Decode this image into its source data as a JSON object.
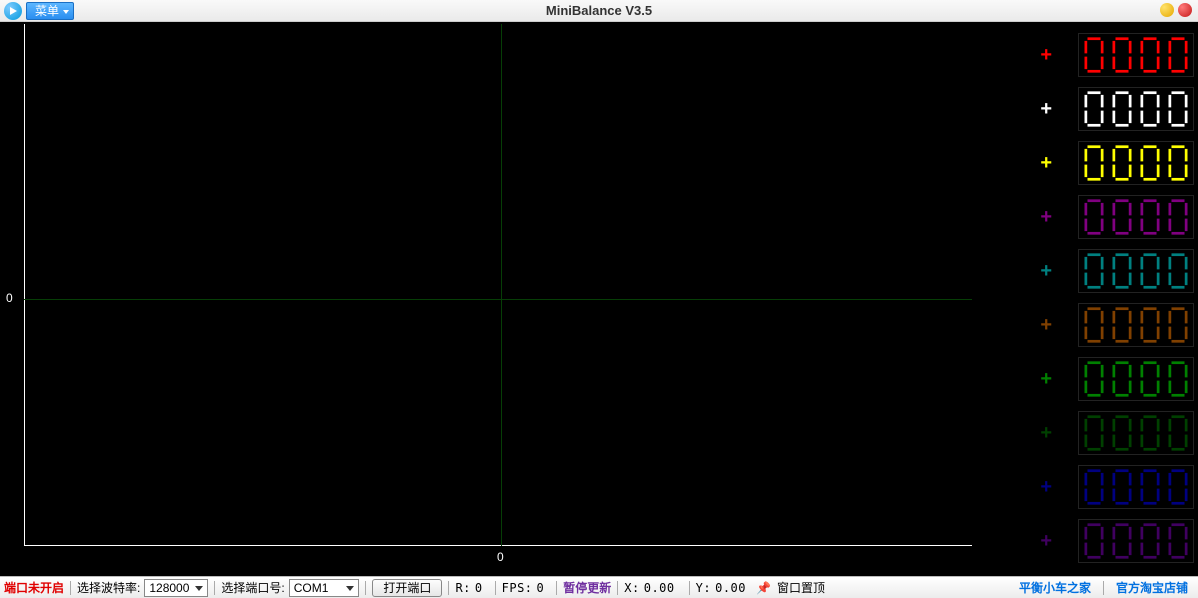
{
  "window": {
    "title": "MiniBalance V3.5",
    "menu_label": "菜单"
  },
  "plot": {
    "y_zero_label": "0",
    "x_zero_label": "0"
  },
  "channels": [
    {
      "color": "#ff0000",
      "value": "0000",
      "sign": "+"
    },
    {
      "color": "#ffffff",
      "value": "0000",
      "sign": "+"
    },
    {
      "color": "#ffff00",
      "value": "0000",
      "sign": "+"
    },
    {
      "color": "#800080",
      "value": "0000",
      "sign": "+"
    },
    {
      "color": "#008080",
      "value": "0000",
      "sign": "+"
    },
    {
      "color": "#804000",
      "value": "0000",
      "sign": "+"
    },
    {
      "color": "#008000",
      "value": "0000",
      "sign": "+"
    },
    {
      "color": "#004000",
      "value": "0000",
      "sign": "+"
    },
    {
      "color": "#000080",
      "value": "0000",
      "sign": "+"
    },
    {
      "color": "#400060",
      "value": "0000",
      "sign": "+"
    }
  ],
  "status": {
    "port_state": "端口未开启",
    "baud_label": "选择波特率:",
    "baud_value": "128000",
    "port_label": "选择端口号:",
    "port_value": "COM1",
    "open_btn": "打开端口",
    "r_label": "R:",
    "r_value": "0",
    "fps_label": "FPS:",
    "fps_value": "0",
    "pause_label": "暂停更新",
    "x_label": "X:",
    "x_value": "0.00",
    "y_label": "Y:",
    "y_value": "0.00",
    "pin_label": "窗口置顶",
    "link1": "平衡小车之家",
    "link2": "官方淘宝店铺"
  }
}
